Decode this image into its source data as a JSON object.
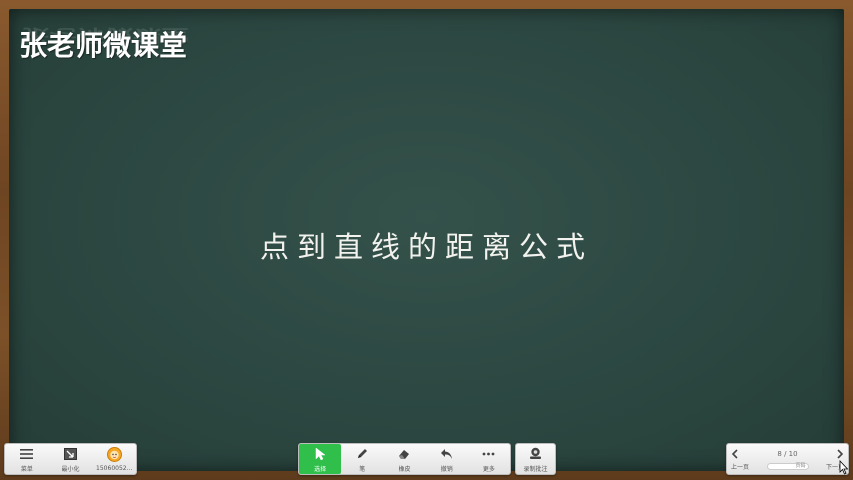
{
  "board": {
    "brand": "张老师微课堂",
    "title": "点到直线的距离公式"
  },
  "toolbar_left": {
    "menu_label": "菜单",
    "minimize_label": "最小化",
    "user_label": "15060052..."
  },
  "toolbar_center": {
    "select_label": "选择",
    "pen_label": "笔",
    "eraser_label": "橡皮",
    "undo_label": "撤销",
    "more_label": "更多"
  },
  "toolbar_record": {
    "record_label": "录制批注"
  },
  "pager": {
    "count": "8 / 10",
    "prev_label": "上一页",
    "page_input": "页码",
    "next_label": "下一页"
  },
  "colors": {
    "board": "#2c4741",
    "frame": "#7c5128",
    "active_tool": "#2fbf4a"
  }
}
